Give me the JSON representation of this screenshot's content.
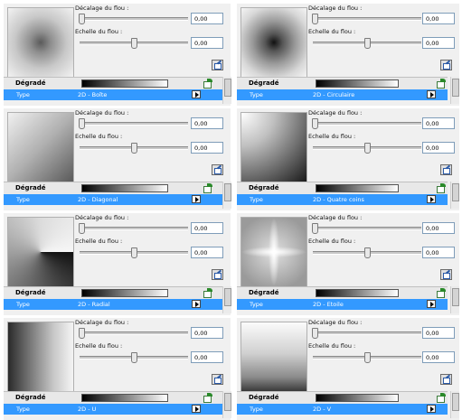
{
  "labels": {
    "offset": "Décalage du flou :",
    "scale": "Echelle du flou :",
    "gradient": "Dégradé",
    "type": "Type"
  },
  "panels": [
    {
      "id": "boite",
      "offset_value": "0,00",
      "scale_value": "0,00",
      "offset_level": 0.0,
      "scale_level": 0.5,
      "type_value": "2D - Boîte"
    },
    {
      "id": "circulaire",
      "offset_value": "0,00",
      "scale_value": "0,00",
      "offset_level": 0.0,
      "scale_level": 0.5,
      "type_value": "2D - Circulaire"
    },
    {
      "id": "diagonal",
      "offset_value": "0,00",
      "scale_value": "0,00",
      "offset_level": 0.0,
      "scale_level": 0.5,
      "type_value": "2D - Diagonal"
    },
    {
      "id": "quatre-coins",
      "offset_value": "0,00",
      "scale_value": "0,00",
      "offset_level": 0.0,
      "scale_level": 0.5,
      "type_value": "2D - Quatre coins"
    },
    {
      "id": "radial",
      "offset_value": "0,00",
      "scale_value": "0,00",
      "offset_level": 0.0,
      "scale_level": 0.5,
      "type_value": "2D - Radial"
    },
    {
      "id": "etoile",
      "offset_value": "0,00",
      "scale_value": "0,00",
      "offset_level": 0.0,
      "scale_level": 0.5,
      "type_value": "2D - Etoile"
    },
    {
      "id": "u",
      "offset_value": "0,00",
      "scale_value": "0,00",
      "offset_level": 0.0,
      "scale_level": 0.5,
      "type_value": "2D - U"
    },
    {
      "id": "v",
      "offset_value": "0,00",
      "scale_value": "0,00",
      "offset_level": 0.0,
      "scale_level": 0.5,
      "type_value": "2D - V"
    }
  ],
  "colors": {
    "selection": "#3399ff",
    "panel_bg": "#f0f0f0"
  },
  "icons": {
    "edit": "edit-icon",
    "gradient_editor": "gradient-edit-icon",
    "dropdown": "dropdown-arrow-icon"
  }
}
